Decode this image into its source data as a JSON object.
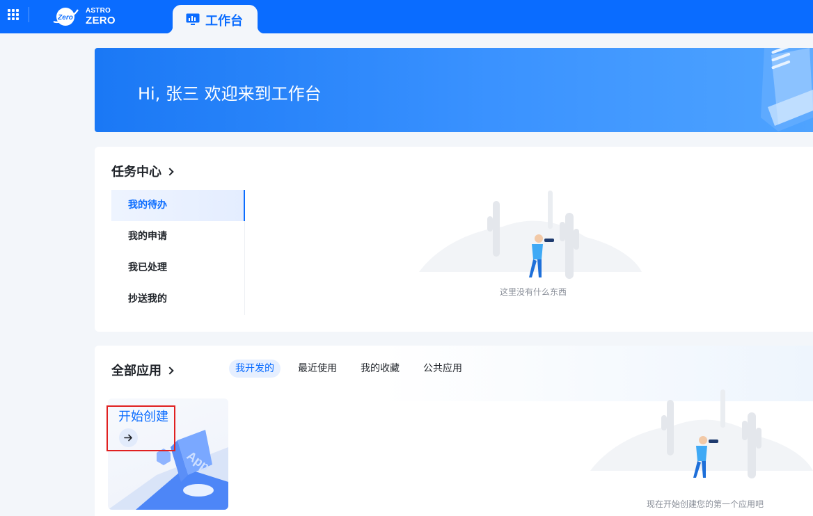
{
  "header": {
    "logo_badge": "Zero",
    "logo_top": "ASTRO",
    "logo_bottom": "ZERO",
    "active_tab": "工作台"
  },
  "banner": {
    "greeting": "Hi, 张三 欢迎来到工作台"
  },
  "task_center": {
    "title": "任务中心",
    "items": [
      {
        "label": "我的待办",
        "active": true
      },
      {
        "label": "我的申请",
        "active": false
      },
      {
        "label": "我已处理",
        "active": false
      },
      {
        "label": "抄送我的",
        "active": false
      }
    ],
    "empty_text": "这里没有什么东西"
  },
  "apps": {
    "title": "全部应用",
    "tabs": [
      {
        "label": "我开发的",
        "active": true
      },
      {
        "label": "最近使用",
        "active": false
      },
      {
        "label": "我的收藏",
        "active": false
      },
      {
        "label": "公共应用",
        "active": false
      }
    ],
    "create_label": "开始创建",
    "create_art_text": "App",
    "empty_text": "现在开始创建您的第一个应用吧"
  },
  "colors": {
    "primary": "#0a6cff",
    "highlight_border": "#e02020"
  }
}
